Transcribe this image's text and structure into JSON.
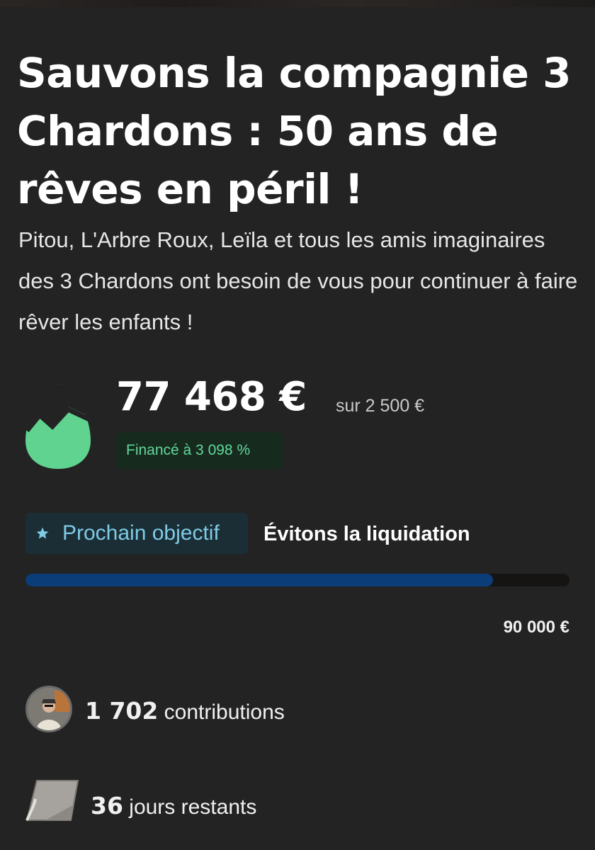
{
  "campaign": {
    "title": "Sauvons la compagnie 3 Chardons : 50 ans de rêves en péril !",
    "subtitle": "Pitou, L'Arbre Roux, Leïla et tous les amis imaginaires des 3 Chardons ont besoin de vous pour continuer à faire rêver les enfants !"
  },
  "funding": {
    "amount": "77 468 €",
    "goal": "sur 2 500 €",
    "funded_badge": "Financé à 3 098 %",
    "icon": "egg-icon"
  },
  "next_goal": {
    "badge_label": "Prochain objectif",
    "name": "Évitons la liquidation",
    "target": "90 000 €",
    "progress_fraction": 0.86
  },
  "stats": {
    "contributions_count": "1 702",
    "contributions_label": " contributions",
    "days_count": "36",
    "days_label": " jours restants"
  },
  "colors": {
    "background": "#232323",
    "egg": "#5fd38f",
    "funded_text": "#5fd89a",
    "next_label": "#7ecbe6",
    "progress": "#0b3d78"
  }
}
